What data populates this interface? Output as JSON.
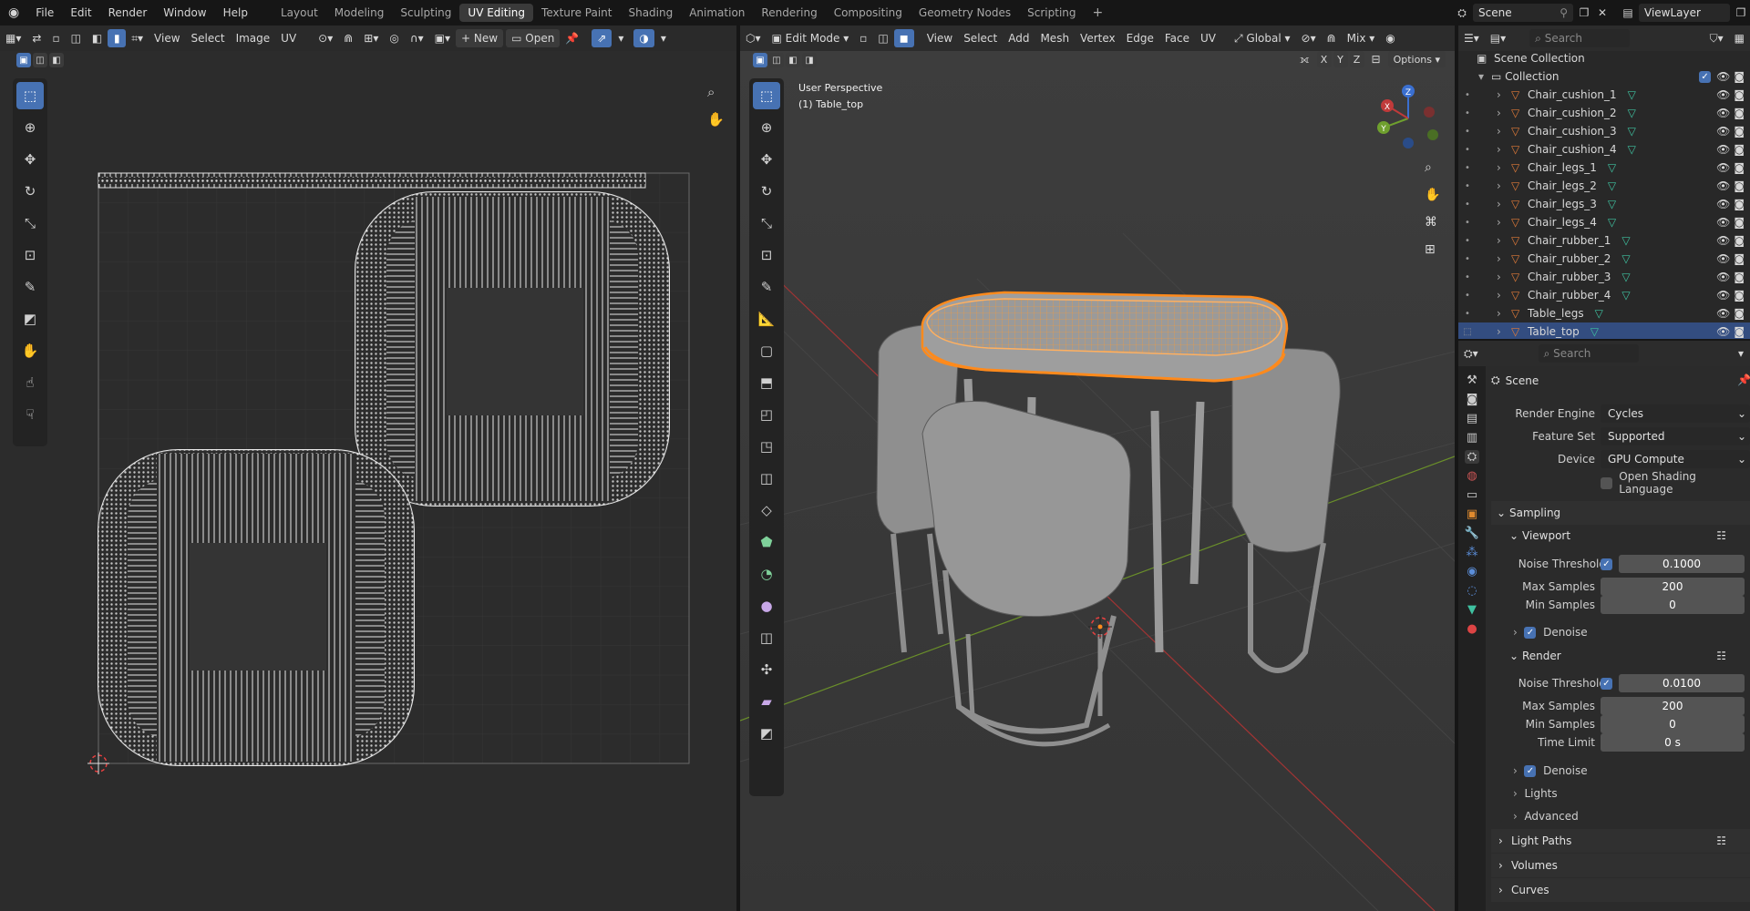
{
  "topbar": {
    "menu": [
      "File",
      "Edit",
      "Render",
      "Window",
      "Help"
    ],
    "workspaces": [
      "Layout",
      "Modeling",
      "Sculpting",
      "UV Editing",
      "Texture Paint",
      "Shading",
      "Animation",
      "Rendering",
      "Compositing",
      "Geometry Nodes",
      "Scripting"
    ],
    "active_workspace": "UV Editing",
    "add_tab": "+",
    "scene": "Scene",
    "view_layer": "ViewLayer"
  },
  "uv_editor": {
    "menus": [
      "View",
      "Select",
      "Image",
      "UV"
    ],
    "new_label": "New",
    "open_label": "Open"
  },
  "viewport": {
    "mode": "Edit Mode",
    "menus": [
      "View",
      "Select",
      "Add",
      "Mesh",
      "Vertex",
      "Edge",
      "Face",
      "UV"
    ],
    "orientation": "Global",
    "shading": "Mix",
    "axes": [
      "X",
      "Y",
      "Z"
    ],
    "options_label": "Options",
    "overlay_title": "User Perspective",
    "overlay_object": "(1) Table_top"
  },
  "outliner": {
    "search_placeholder": "Search",
    "scene_collection": "Scene Collection",
    "collection": "Collection",
    "items": [
      "Chair_cushion_1",
      "Chair_cushion_2",
      "Chair_cushion_3",
      "Chair_cushion_4",
      "Chair_legs_1",
      "Chair_legs_2",
      "Chair_legs_3",
      "Chair_legs_4",
      "Chair_rubber_1",
      "Chair_rubber_2",
      "Chair_rubber_3",
      "Chair_rubber_4",
      "Table_legs",
      "Table_top"
    ],
    "selected": "Table_top"
  },
  "properties": {
    "search_placeholder": "Search",
    "context": "Scene",
    "render_engine_label": "Render Engine",
    "render_engine": "Cycles",
    "feature_set_label": "Feature Set",
    "feature_set": "Supported",
    "device_label": "Device",
    "device": "GPU Compute",
    "osl_label": "Open Shading Language",
    "sampling": "Sampling",
    "viewport": "Viewport",
    "noise_threshold_label": "Noise Threshold",
    "vp_noise_threshold": "0.1000",
    "max_samples_label": "Max Samples",
    "vp_max_samples": "200",
    "min_samples_label": "Min Samples",
    "vp_min_samples": "0",
    "denoise_label": "Denoise",
    "render": "Render",
    "r_noise_threshold": "0.0100",
    "r_max_samples": "200",
    "r_min_samples": "0",
    "time_limit_label": "Time Limit",
    "time_limit": "0 s",
    "lights": "Lights",
    "advanced": "Advanced",
    "light_paths": "Light Paths",
    "volumes": "Volumes",
    "curves": "Curves"
  },
  "colors": {
    "accent": "#4772b3",
    "selection_orange": "#ff8a1c",
    "mesh_icon": "#e07b39",
    "vertex_group_icon": "#3fc1a0"
  }
}
